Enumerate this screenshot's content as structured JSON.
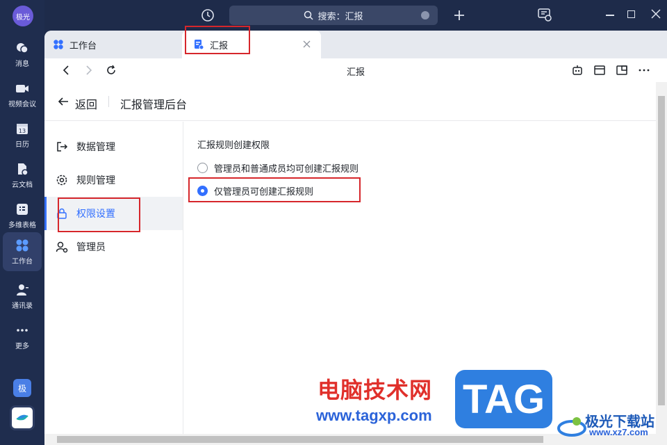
{
  "sidebar": {
    "avatar": "极光",
    "items": [
      {
        "label": "消息",
        "icon": "chat-icon"
      },
      {
        "label": "视频会议",
        "icon": "video-icon"
      },
      {
        "label": "日历",
        "icon": "calendar-icon",
        "day": "13"
      },
      {
        "label": "云文档",
        "icon": "cloud-doc-icon"
      },
      {
        "label": "多维表格",
        "icon": "table-icon"
      },
      {
        "label": "工作台",
        "icon": "workspace-icon",
        "active": true
      },
      {
        "label": "通讯录",
        "icon": "contacts-icon"
      },
      {
        "label": "更多",
        "icon": "more-icon"
      }
    ],
    "badge": "极"
  },
  "topbar": {
    "search_text": "搜索：汇报"
  },
  "tabs": [
    {
      "label": "工作台",
      "icon": "workspace-icon"
    },
    {
      "label": "汇报",
      "icon": "report-icon",
      "active": true
    }
  ],
  "navbar": {
    "title": "汇报"
  },
  "header": {
    "back_label": "返回",
    "page_title": "汇报管理后台"
  },
  "menu": [
    {
      "label": "数据管理",
      "icon": "export-icon"
    },
    {
      "label": "规则管理",
      "icon": "gear-icon"
    },
    {
      "label": "权限设置",
      "icon": "lock-icon",
      "active": true
    },
    {
      "label": "管理员",
      "icon": "admin-icon"
    }
  ],
  "permission": {
    "section_title": "汇报规则创建权限",
    "options": [
      {
        "label": "管理员和普通成员均可创建汇报规则",
        "checked": false
      },
      {
        "label": "仅管理员可创建汇报规则",
        "checked": true
      }
    ]
  },
  "watermark": {
    "site_cn": "电脑技术网",
    "site_url": "www.tagxp.com",
    "tag": "TAG",
    "brand_cn": "极光下载站",
    "brand_url": "www.xz7.com"
  },
  "colors": {
    "accent": "#3370ff",
    "highlight": "#d6262b",
    "rail_bg": "#1f2d4e"
  }
}
